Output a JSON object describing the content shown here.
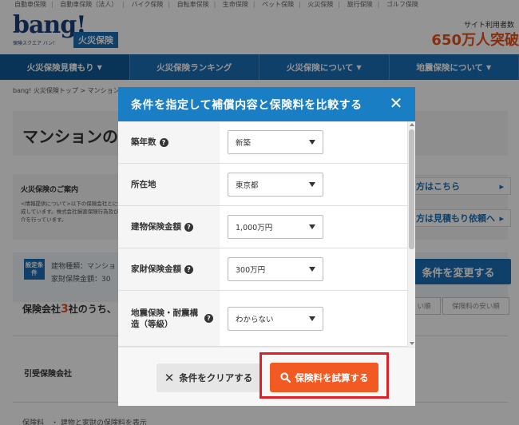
{
  "topnav": {
    "items": [
      "自動車保険",
      "自動車保険（法人）",
      "バイク保険",
      "自転車保険",
      "生命保険",
      "ペット保険",
      "火災保険",
      "旅行保険",
      "ゴルフ保険"
    ]
  },
  "header": {
    "logo_text": "bang!",
    "logo_sub": "保険スクエア バン！",
    "fire_badge": "火災保険",
    "sitecount_label": "サイト利用者数",
    "sitecount_value": "650万人突破"
  },
  "mainnav": {
    "items": [
      "火災保険見積もり",
      "火災保険ランキング",
      "火災保険について",
      "地震保険について"
    ]
  },
  "background": {
    "breadcrumb": "bang! 火災保険トップ > マンション",
    "page_title": "マンションの",
    "info_label": "火災保険のご案内",
    "info_text": "<情報提供について>以下の保険会社とに作成しています。株式会社損害保険行為及び媒介を行っています。",
    "link1": "方はこちら",
    "link2": "方は見積もり依頼へ",
    "cond_tag": "設定条件",
    "cond_line1": "建物種類：マンショ",
    "cond_line2": "家財保険金額：30",
    "change_button": "条件を変更する",
    "count_prefix": "保険会社",
    "count_num": "3",
    "count_suffix": "社のうち、",
    "sort1": "い順",
    "sort2": "保険料の安い順",
    "company_name": "引受保険会社",
    "bottom_text": "保険料　・ 建物と家財の保険料を表示"
  },
  "modal": {
    "title": "条件を指定して補償内容と保険料を比較する",
    "close_label": "✕",
    "fields": [
      {
        "label": "築年数",
        "value": "新築",
        "help": true
      },
      {
        "label": "所在地",
        "value": "東京都",
        "help": false
      },
      {
        "label": "建物保険金額",
        "value": "1,000万円",
        "help": true
      },
      {
        "label": "家財保険金額",
        "value": "300万円",
        "help": true
      },
      {
        "label": "地震保険・耐震構造（等級）",
        "value": "わからない",
        "help": true
      }
    ],
    "clear_button": "条件をクリアする",
    "calc_button": "保険料を試算する"
  },
  "colors": {
    "brand_blue": "#1a6fb5",
    "modal_header": "#1a7ec5",
    "accent_orange": "#f15a22",
    "highlight_red": "#e01e26"
  }
}
